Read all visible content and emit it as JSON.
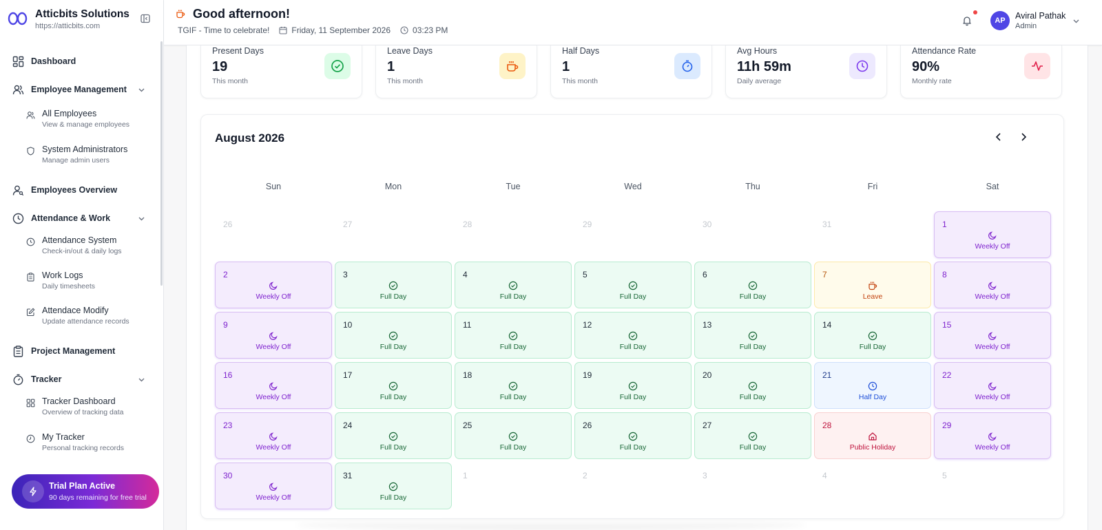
{
  "brand": {
    "name": "Atticbits Solutions",
    "url": "https://atticbits.com"
  },
  "nav": {
    "dashboard": "Dashboard",
    "employee_management": "Employee Management",
    "all_employees": {
      "title": "All Employees",
      "sub": "View & manage employees"
    },
    "system_admins": {
      "title": "System Administrators",
      "sub": "Manage admin users"
    },
    "employees_overview": "Employees Overview",
    "attendance_work": "Attendance & Work",
    "attendance_system": {
      "title": "Attendance System",
      "sub": "Check-in/out & daily logs"
    },
    "work_logs": {
      "title": "Work Logs",
      "sub": "Daily timesheets"
    },
    "attendance_modify": {
      "title": "Attendace Modify",
      "sub": "Update attendance records"
    },
    "project_management": "Project Management",
    "tracker": "Tracker",
    "tracker_dashboard": {
      "title": "Tracker Dashboard",
      "sub": "Overview of tracking data"
    },
    "my_tracker": {
      "title": "My Tracker",
      "sub": "Personal tracking records"
    }
  },
  "trial": {
    "title": "Trial Plan Active",
    "sub": "90 days remaining for free trial"
  },
  "header": {
    "greeting": "Good afternoon!",
    "tagline": "TGIF - Time to celebrate!",
    "date": "Friday, 11 September 2026",
    "time": "03:23 PM"
  },
  "user": {
    "initials": "AP",
    "name": "Aviral Pathak",
    "role": "Admin"
  },
  "stats": [
    {
      "title": "Present Days",
      "value": "19",
      "sub": "This month",
      "icon": "check-circle-icon",
      "color": "#16a34a",
      "bg": "#dcfce7"
    },
    {
      "title": "Leave Days",
      "value": "1",
      "sub": "This month",
      "icon": "coffee-icon",
      "color": "#ea580c",
      "bg": "#fef3c7"
    },
    {
      "title": "Half Days",
      "value": "1",
      "sub": "This month",
      "icon": "timer-icon",
      "color": "#2563eb",
      "bg": "#dbeafe"
    },
    {
      "title": "Avg Hours",
      "value": "11h 59m",
      "sub": "Daily average",
      "icon": "clock-icon",
      "color": "#7c3aed",
      "bg": "#ede9fe"
    },
    {
      "title": "Attendance Rate",
      "value": "90%",
      "sub": "Monthly rate",
      "icon": "activity-icon",
      "color": "#e11d48",
      "bg": "#ffe4e6"
    }
  ],
  "calendar": {
    "month": "August 2026",
    "weekdays": [
      "Sun",
      "Mon",
      "Tue",
      "Wed",
      "Thu",
      "Fri",
      "Sat"
    ],
    "labels": {
      "w": "Weekly Off",
      "f": "Full Day",
      "l": "Leave",
      "h": "Half Day",
      "p": "Public Holiday"
    },
    "days": [
      {
        "d": "26",
        "k": "o"
      },
      {
        "d": "27",
        "k": "o"
      },
      {
        "d": "28",
        "k": "o"
      },
      {
        "d": "29",
        "k": "o"
      },
      {
        "d": "30",
        "k": "o"
      },
      {
        "d": "31",
        "k": "o"
      },
      {
        "d": "1",
        "k": "w"
      },
      {
        "d": "2",
        "k": "w"
      },
      {
        "d": "3",
        "k": "f"
      },
      {
        "d": "4",
        "k": "f"
      },
      {
        "d": "5",
        "k": "f"
      },
      {
        "d": "6",
        "k": "f"
      },
      {
        "d": "7",
        "k": "l"
      },
      {
        "d": "8",
        "k": "w"
      },
      {
        "d": "9",
        "k": "w"
      },
      {
        "d": "10",
        "k": "f"
      },
      {
        "d": "11",
        "k": "f"
      },
      {
        "d": "12",
        "k": "f"
      },
      {
        "d": "13",
        "k": "f"
      },
      {
        "d": "14",
        "k": "f"
      },
      {
        "d": "15",
        "k": "w"
      },
      {
        "d": "16",
        "k": "w"
      },
      {
        "d": "17",
        "k": "f"
      },
      {
        "d": "18",
        "k": "f"
      },
      {
        "d": "19",
        "k": "f"
      },
      {
        "d": "20",
        "k": "f"
      },
      {
        "d": "21",
        "k": "h"
      },
      {
        "d": "22",
        "k": "w"
      },
      {
        "d": "23",
        "k": "w"
      },
      {
        "d": "24",
        "k": "f"
      },
      {
        "d": "25",
        "k": "f"
      },
      {
        "d": "26",
        "k": "f"
      },
      {
        "d": "27",
        "k": "f"
      },
      {
        "d": "28",
        "k": "p"
      },
      {
        "d": "29",
        "k": "w"
      },
      {
        "d": "30",
        "k": "w"
      },
      {
        "d": "31",
        "k": "f"
      },
      {
        "d": "1",
        "k": "o"
      },
      {
        "d": "2",
        "k": "o"
      },
      {
        "d": "3",
        "k": "o"
      },
      {
        "d": "4",
        "k": "o"
      },
      {
        "d": "5",
        "k": "o"
      }
    ]
  }
}
